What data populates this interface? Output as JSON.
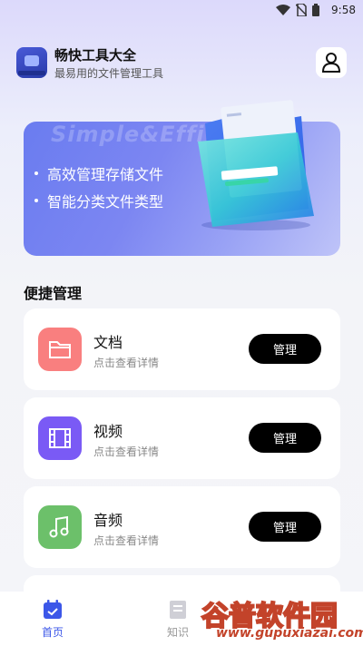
{
  "status_bar": {
    "time": "9:58",
    "icons": [
      "wifi-icon",
      "sim-off-icon",
      "battery-icon"
    ]
  },
  "header": {
    "title": "畅快工具大全",
    "subtitle": "最易用的文件管理工具",
    "logo_icon": "briefcase-app-icon",
    "profile_icon": "user-icon"
  },
  "banner": {
    "watermark": "Simple&Effi",
    "features": [
      "高效管理存储文件",
      "智能分类文件类型"
    ],
    "image_icon": "folder-icon"
  },
  "section": {
    "title": "便捷管理"
  },
  "cards": [
    {
      "name": "文档",
      "desc": "点击查看详情",
      "button": "管理",
      "icon": "folder-icon",
      "color": "#f97f7f"
    },
    {
      "name": "视频",
      "desc": "点击查看详情",
      "button": "管理",
      "icon": "film-icon",
      "color": "#7a5af5"
    },
    {
      "name": "音频",
      "desc": "点击查看详情",
      "button": "管理",
      "icon": "music-note-icon",
      "color": "#6cc06a"
    }
  ],
  "tabs": [
    {
      "label": "首页",
      "icon": "calendar-icon",
      "active": true
    },
    {
      "label": "知识",
      "icon": "document-icon",
      "active": false
    }
  ],
  "watermark_site": {
    "big": "谷普软件园",
    "small": "www.gupuxiazai.com"
  },
  "colors": {
    "accent": "#3c57e8",
    "button": "#000000"
  }
}
